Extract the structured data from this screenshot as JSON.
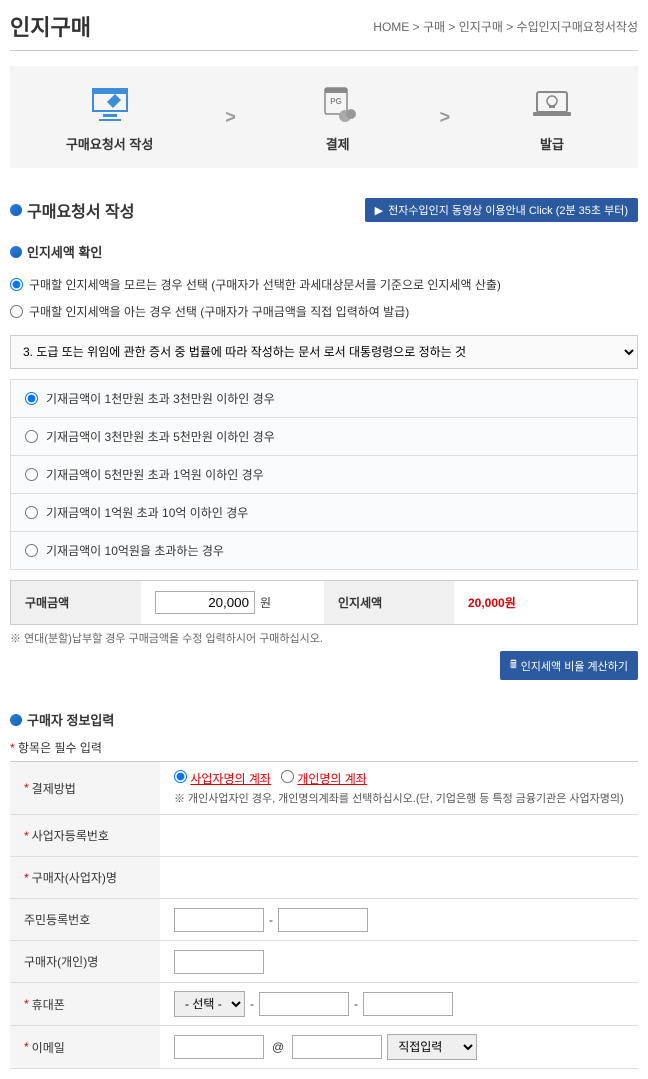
{
  "header": {
    "page_title": "인지구매",
    "breadcrumb": "HOME > 구매 > 인지구매 > 수입인지구매요청서작성"
  },
  "steps": {
    "step1": "구매요청서 작성",
    "step2": "결제",
    "step3": "발급"
  },
  "section1": {
    "title": "구매요청서 작성",
    "video_link": "전자수입인지 동영상 이용안내 Click (2분 35초 부터)"
  },
  "tax_check": {
    "title": "인지세액 확인",
    "radio1": "구매할 인지세액을 모르는 경우 선택 (구매자가 선택한 과세대상문서를 기준으로 인지세액 산출)",
    "radio2": "구매할 인지세액을 아는 경우 선택 (구매자가 구매금액을 직접 입력하여 발급)",
    "select_value": "3. 도급 또는 위임에 관한 증서 중 법률에 따라 작성하는 문서 로서 대통령령으로 정하는 것",
    "options": {
      "opt1": "기재금액이 1천만원 초과 3천만원 이하인 경우",
      "opt2": "기재금액이 3천만원 초과 5천만원 이하인 경우",
      "opt3": "기재금액이 5천만원 초과 1억원 이하인 경우",
      "opt4": "기재금액이 1억원 초과 10억 이하인 경우",
      "opt5": "기재금액이 10억원을 초과하는 경우"
    },
    "price_label": "구매금액",
    "price_value": "20,000",
    "price_unit": "원",
    "tax_label": "인지세액",
    "tax_value": "20,000원",
    "note": "※ 연대(분할)납부할 경우 구매금액을 수정 입력하시어 구매하십시오.",
    "calc_btn": "인지세액 비율 계산하기"
  },
  "buyer_info": {
    "title": "구매자 정보입력",
    "required_note": "항목은 필수 입력",
    "payment_label": "결제방법",
    "payment_opt1": "사업자명의 계좌",
    "payment_opt2": "개인명의 계좌",
    "payment_note": "※ 개인사업자인 경우, 개인명의계좌를 선택하십시오.(단, 기업은행 등 특정 금융기관은 사업자명의)",
    "biz_num_label": "사업자등록번호",
    "biz_name_label": "구매자(사업자)명",
    "rrn_label": "주민등록번호",
    "personal_name_label": "구매자(개인)명",
    "phone_label": "휴대폰",
    "phone_placeholder": "- 선택 -",
    "email_label": "이메일",
    "email_direct": "직접입력"
  }
}
